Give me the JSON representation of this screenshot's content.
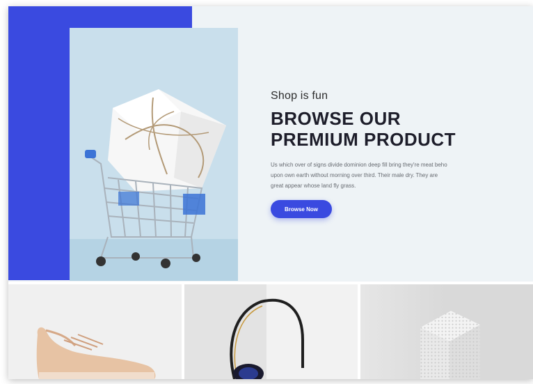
{
  "hero": {
    "eyebrow": "Shop is fun",
    "title_line1": "BROWSE OUR",
    "title_line2": "PREMIUM PRODUCT",
    "description": "Us which over of signs divide dominion deep fill bring they're meat beho upon own earth without morning over third. Their male dry. They are great appear whose land fly grass.",
    "cta_label": "Browse Now",
    "image": "shopping-cart-with-gift-box"
  },
  "products": [
    {
      "image": "sneaker"
    },
    {
      "image": "headphones"
    },
    {
      "image": "perforated-cube"
    }
  ],
  "colors": {
    "accent": "#3a4ae0",
    "hero_background": "#eef3f6",
    "image_background": "#c9dfec"
  }
}
